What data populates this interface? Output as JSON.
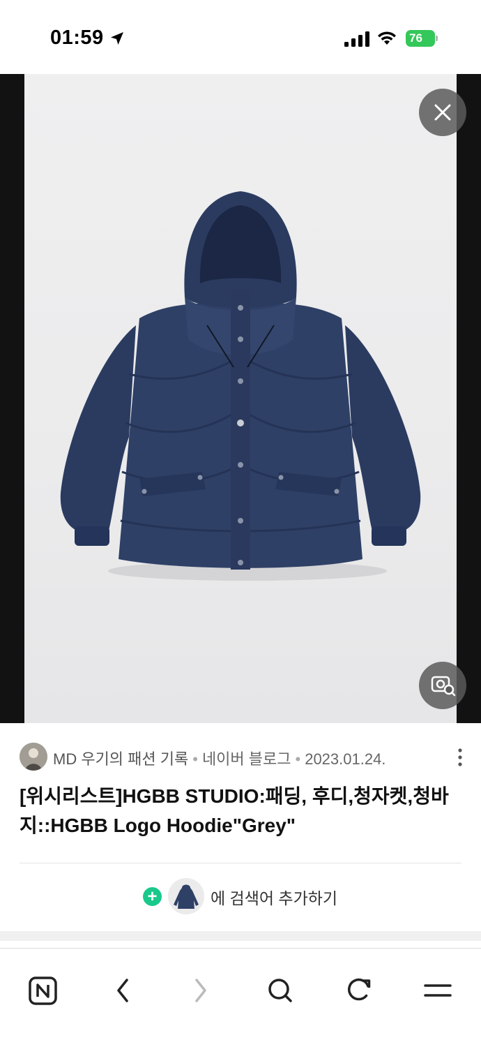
{
  "status_bar": {
    "time": "01:59",
    "battery": "76"
  },
  "icons": {
    "location": "location-arrow-icon",
    "signal": "cellular-signal-icon",
    "wifi": "wifi-icon",
    "close": "close-icon",
    "lens": "image-search-icon",
    "more": "more-vertical-icon",
    "add": "plus-icon",
    "home": "naver-home-icon",
    "back": "chevron-left-icon",
    "forward": "chevron-right-icon",
    "search": "search-icon",
    "refresh": "refresh-icon",
    "menu": "menu-icon"
  },
  "image": {
    "subject": "navy puffer jacket"
  },
  "source": {
    "name": "MD 우기의 패션 기록",
    "site": "네이버 블로그",
    "date": "2023.01.24."
  },
  "title": "[위시리스트]HGBB STUDIO:패딩, 후디,청자켓,청바지::HGBB Logo Hoodie\"Grey\"",
  "add_search": {
    "label": "에 검색어 추가하기"
  },
  "colors": {
    "accent_green": "#19c98b",
    "battery_green": "#34c759",
    "jacket_navy": "#2e3f64"
  }
}
